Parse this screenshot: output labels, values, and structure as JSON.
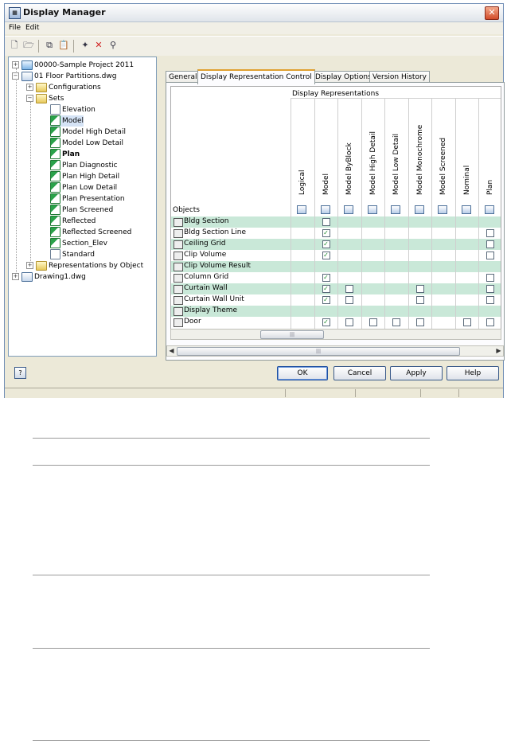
{
  "window": {
    "title": "Display Manager",
    "close_symbol": "✕"
  },
  "menu": {
    "file": "File",
    "edit": "Edit"
  },
  "toolbar": {
    "icons": [
      "new-icon",
      "open-icon",
      "copy-icon",
      "paste-icon",
      "new-display-icon",
      "delete-icon",
      "purge-icon"
    ]
  },
  "tree": {
    "items": [
      {
        "label": "00000-Sample Project 2011"
      },
      {
        "label": "01 Floor Partitions.dwg"
      },
      {
        "label": "Configurations"
      },
      {
        "label": "Sets"
      },
      {
        "label": "Elevation"
      },
      {
        "label": "Model"
      },
      {
        "label": "Model High Detail"
      },
      {
        "label": "Model Low Detail"
      },
      {
        "label": "Plan"
      },
      {
        "label": "Plan Diagnostic"
      },
      {
        "label": "Plan High Detail"
      },
      {
        "label": "Plan Low Detail"
      },
      {
        "label": "Plan Presentation"
      },
      {
        "label": "Plan Screened"
      },
      {
        "label": "Reflected"
      },
      {
        "label": "Reflected Screened"
      },
      {
        "label": "Section_Elev"
      },
      {
        "label": "Standard"
      },
      {
        "label": "Representations by Object"
      },
      {
        "label": "Drawing1.dwg"
      }
    ]
  },
  "tabs": [
    {
      "label": "General"
    },
    {
      "label": "Display Representation Control"
    },
    {
      "label": "Display Options"
    },
    {
      "label": "Version History"
    }
  ],
  "grid": {
    "group_header": "Display Representations",
    "objects_header": "Objects",
    "columns": [
      "Logical",
      "Model",
      "Model ByBlock",
      "Model High Detail",
      "Model Low Detail",
      "Model Monochrome",
      "Model Screened",
      "Nominal",
      "Plan"
    ],
    "rows": [
      {
        "name": "Bldg Section",
        "checks": [
          "",
          "c0",
          "",
          "",
          "",
          "",
          "",
          "",
          ""
        ]
      },
      {
        "name": "Bldg Section Line",
        "checks": [
          "",
          "c1",
          "",
          "",
          "",
          "",
          "",
          "",
          "c0"
        ]
      },
      {
        "name": "Ceiling Grid",
        "checks": [
          "",
          "c1",
          "",
          "",
          "",
          "",
          "",
          "",
          "c0"
        ]
      },
      {
        "name": "Clip Volume",
        "checks": [
          "",
          "c1",
          "",
          "",
          "",
          "",
          "",
          "",
          "c0"
        ]
      },
      {
        "name": "Clip Volume Result",
        "checks": [
          "",
          "",
          "",
          "",
          "",
          "",
          "",
          "",
          ""
        ]
      },
      {
        "name": "Column Grid",
        "checks": [
          "",
          "c1",
          "",
          "",
          "",
          "",
          "",
          "",
          "c0"
        ]
      },
      {
        "name": "Curtain Wall",
        "checks": [
          "",
          "c1",
          "c0",
          "",
          "",
          "c0",
          "",
          "",
          "c0"
        ]
      },
      {
        "name": "Curtain Wall Unit",
        "checks": [
          "",
          "c1",
          "c0",
          "",
          "",
          "c0",
          "",
          "",
          "c0"
        ]
      },
      {
        "name": "Display Theme",
        "checks": [
          "",
          "",
          "",
          "",
          "",
          "",
          "",
          "",
          ""
        ]
      },
      {
        "name": "Door",
        "checks": [
          "",
          "c1",
          "c0",
          "c0",
          "c0",
          "c0",
          "",
          "c0",
          "c0"
        ]
      }
    ],
    "check_mark": "✓"
  },
  "buttons": {
    "ok": "OK",
    "cancel": "Cancel",
    "apply": "Apply",
    "help": "Help"
  }
}
